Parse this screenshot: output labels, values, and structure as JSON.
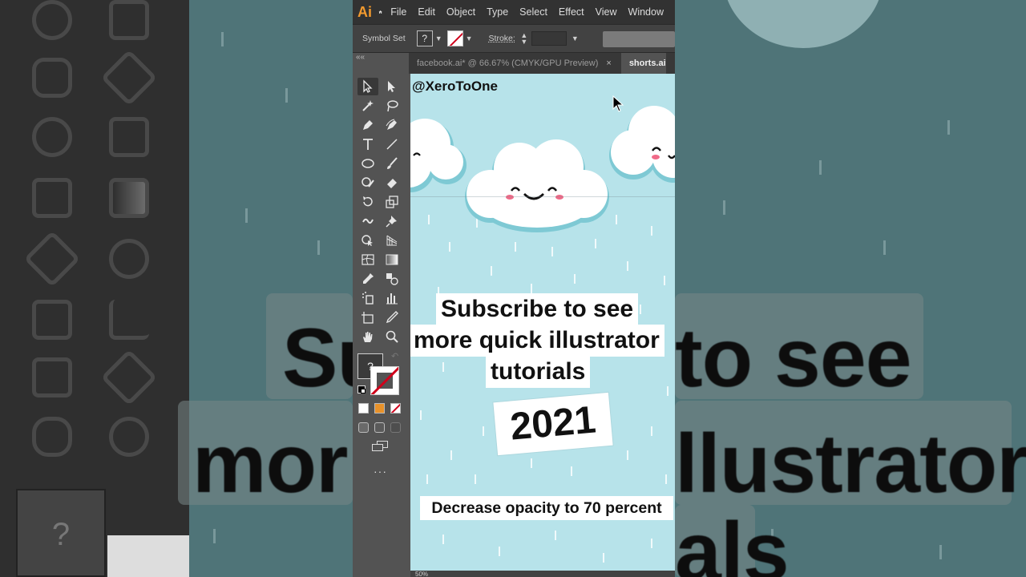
{
  "app": {
    "logo": "Ai",
    "menu": [
      "File",
      "Edit",
      "Object",
      "Type",
      "Select",
      "Effect",
      "View",
      "Window"
    ]
  },
  "control_bar": {
    "label": "Symbol Set",
    "fill_swatch": "?",
    "stroke_label": "Stroke:"
  },
  "tabs": [
    {
      "label": "facebook.ai* @ 66.67% (CMYK/GPU Preview)",
      "close": "×",
      "active": false
    },
    {
      "label": "shorts.ai",
      "active": true
    }
  ],
  "toolbar": {
    "fill_label": "?",
    "collapse": "««",
    "more": "···"
  },
  "canvas": {
    "watermark": "@XeroToOne",
    "subscribe_lines": [
      "Subscribe to see",
      "more quick illustrator",
      "tutorials"
    ],
    "year": "2021",
    "caption": "Decrease opacity to 70 percent",
    "background_color": "#b7e3ea"
  },
  "status": {
    "zoom": "50%"
  },
  "background": {
    "big_text_left_1": "Su",
    "big_text_left_2": "mor",
    "big_text_right_1": "to see",
    "big_text_right_2": "llustrator",
    "big_text_right_3": "als",
    "fill_label": "?"
  }
}
